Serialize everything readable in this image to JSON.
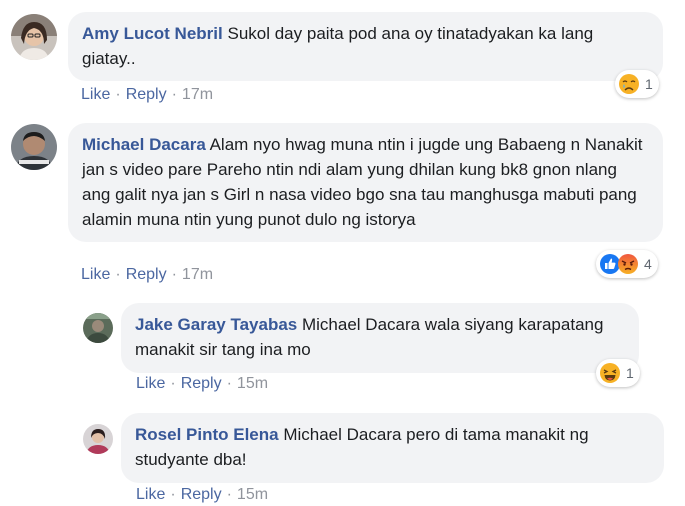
{
  "comments": [
    {
      "author": "Amy Lucot Nebril",
      "text": "Sukol day paita pod ana oy tinatadyakan ka lang giatay..",
      "like_label": "Like",
      "reply_label": "Reply",
      "time": "17m",
      "reactions": [
        "crying-face-icon"
      ],
      "reaction_count": "1"
    },
    {
      "author": "Michael Dacara",
      "text": "Alam nyo hwag muna ntin i jugde ung Babaeng n Nanakit jan s video pare Pareho ntin ndi alam yung dhilan kung bk8 gnon nlang ang galit nya jan s Girl n nasa video bgo sna tau manghusga mabuti pang alamin muna ntin yung punot dulo ng istorya",
      "like_label": "Like",
      "reply_label": "Reply",
      "time": "17m",
      "reactions": [
        "like-icon",
        "angry-face-icon"
      ],
      "reaction_count": "4"
    }
  ],
  "replies": [
    {
      "author": "Jake Garay Tayabas",
      "text": "Michael Dacara wala siyang karapatang manakit sir tang ina mo",
      "like_label": "Like",
      "reply_label": "Reply",
      "time": "15m",
      "reactions": [
        "laughing-face-icon"
      ],
      "reaction_count": "1"
    },
    {
      "author": "Rosel Pinto Elena",
      "text": "Michael Dacara pero di tama manakit ng studyante dba!",
      "like_label": "Like",
      "reply_label": "Reply",
      "time": "15m"
    }
  ],
  "colors": {
    "name": "#385898",
    "bubble": "#f2f3f5",
    "link": "#4b67a1",
    "meta": "#90949c",
    "like_blue": "#1877f2",
    "angry_red": "#f0573f",
    "emoji_yellow": "#f7b125"
  }
}
